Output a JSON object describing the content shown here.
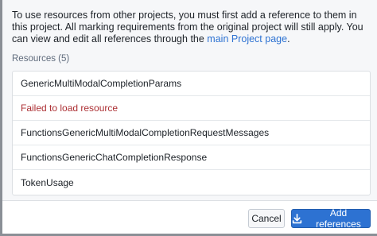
{
  "dialog": {
    "intro_text": "To use resources from other projects, you must first add a reference to them in this project. All marking requirements from the original project will still apply. You can view and edit all references through the ",
    "intro_link": "main Project page",
    "intro_end": ".",
    "resources_label": "Resources (5)",
    "resources": [
      {
        "label": "GenericMultiModalCompletionParams",
        "status": "ok"
      },
      {
        "label": "Failed to load resource",
        "status": "error"
      },
      {
        "label": "FunctionsGenericMultiModalCompletionRequestMessages",
        "status": "ok"
      },
      {
        "label": "FunctionsGenericChatCompletionResponse",
        "status": "ok"
      },
      {
        "label": "TokenUsage",
        "status": "ok"
      }
    ],
    "cancel_label": "Cancel",
    "add_label": "Add references",
    "add_icon": "import-icon"
  },
  "colors": {
    "primary": "#2d72d2",
    "error": "#ac2f33",
    "muted": "#5f6b7c"
  }
}
